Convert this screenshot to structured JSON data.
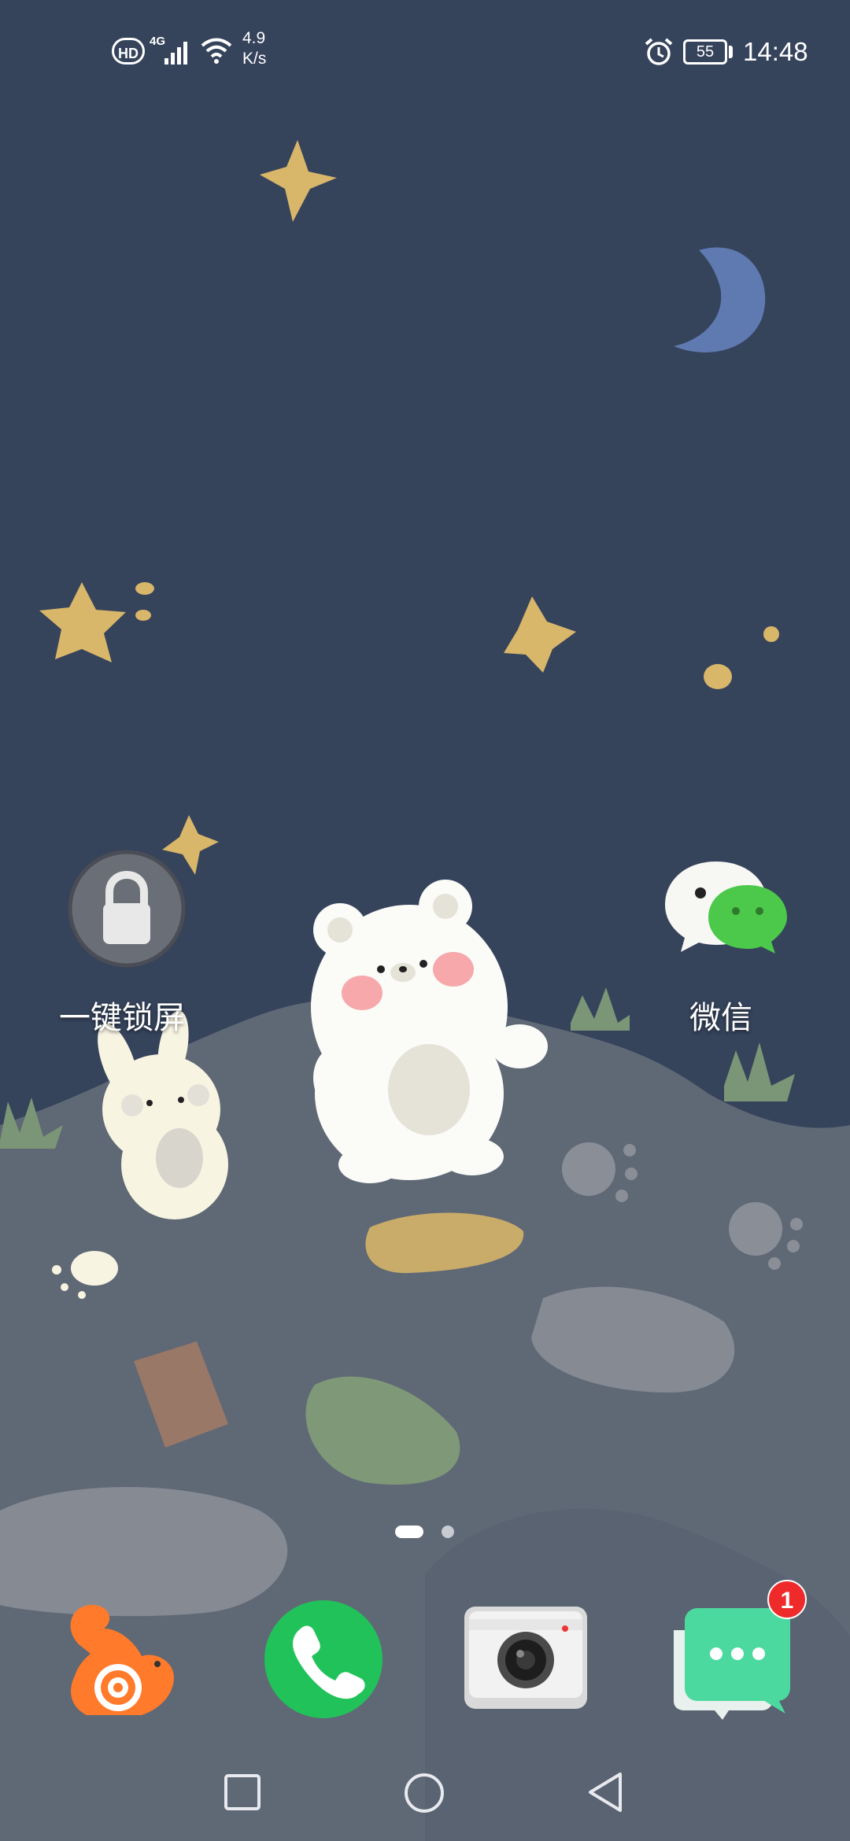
{
  "status_bar": {
    "hd_label": "HD",
    "network_type": "4G",
    "net_speed_value": "4.9",
    "net_speed_unit": "K/s",
    "battery_level": "55",
    "time": "14:48"
  },
  "desktop_icons": [
    {
      "label": "一键锁屏",
      "icon": "lock-icon"
    },
    {
      "label": "微信",
      "icon": "wechat-icon"
    }
  ],
  "page_indicator": {
    "page_count": 2,
    "current_page": 1
  },
  "dock": [
    {
      "app": "uc-browser",
      "icon": "uc-squirrel-icon"
    },
    {
      "app": "phone",
      "icon": "phone-icon"
    },
    {
      "app": "camera",
      "icon": "camera-icon"
    },
    {
      "app": "messages",
      "icon": "message-bubble-icon",
      "badge": "1"
    }
  ],
  "nav_bar": {
    "buttons": [
      "recents-button",
      "home-button",
      "back-button"
    ]
  },
  "colors": {
    "sky": "#35435b",
    "hill": "#5f6875",
    "star": "#d8b66a",
    "moon": "#5e7ab0",
    "phone_green": "#22c25a",
    "message_green": "#4cd9a0",
    "badge_red": "#ee2a2a",
    "uc_orange": "#ff7a2a"
  }
}
